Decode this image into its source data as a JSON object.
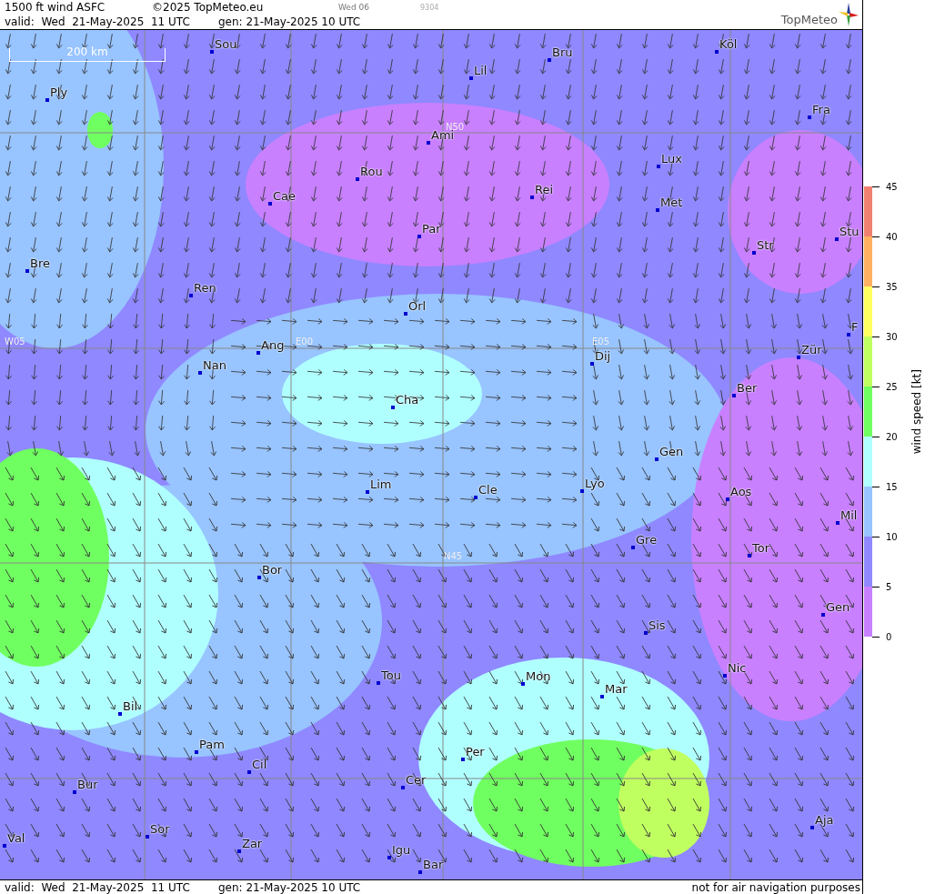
{
  "header": {
    "product": "1500 ft wind ASFC",
    "copyright": "©2025 TopMeteo.eu",
    "run": "Wed 06",
    "code": "9304",
    "valid": "valid:  Wed  21-May-2025  11 UTC",
    "gen": "gen: 21-May-2025 10 UTC",
    "logo": "TopMeteo"
  },
  "map": {
    "scale": "200 km",
    "grid_labels": [
      "N50",
      "W05",
      "E00",
      "E05",
      "N45"
    ],
    "cities": [
      "Sou",
      "Ply",
      "Lil",
      "Bru",
      "Köl",
      "Ami",
      "Fra",
      "Rou",
      "Cae",
      "Lux",
      "Rei",
      "Met",
      "Par",
      "Stu",
      "Str",
      "Bre",
      "Ren",
      "Orl",
      "F",
      "Ang",
      "Nan",
      "Dij",
      "Zür",
      "Ber",
      "Cha",
      "Gen",
      "Lim",
      "Cle",
      "Lyo",
      "Aos",
      "Mil",
      "Gre",
      "Tor",
      "Bor",
      "Gen",
      "Sis",
      "Tou",
      "Mon",
      "Mar",
      "Nic",
      "Bil",
      "Pam",
      "Cil",
      "Per",
      "Cer",
      "Bur",
      "Sor",
      "Aja",
      "Val",
      "Zar",
      "Igu",
      "Bar"
    ]
  },
  "legend": {
    "title": "wind speed [kt]",
    "ticks": [
      "45",
      "40",
      "35",
      "30",
      "25",
      "20",
      "15",
      "10",
      "5",
      "0"
    ],
    "bands": [
      {
        "color": "#f08070"
      },
      {
        "color": "#ffb060"
      },
      {
        "color": "#ffff60"
      },
      {
        "color": "#c0ff60"
      },
      {
        "color": "#70ff60"
      },
      {
        "color": "#b0ffff"
      },
      {
        "color": "#98c4ff"
      },
      {
        "color": "#8f88ff"
      },
      {
        "color": "#c880ff"
      }
    ]
  },
  "footer": {
    "valid": "valid:  Wed  21-May-2025  11 UTC",
    "gen": "gen: 21-May-2025 10 UTC",
    "note": "not for air navigation purposes"
  }
}
